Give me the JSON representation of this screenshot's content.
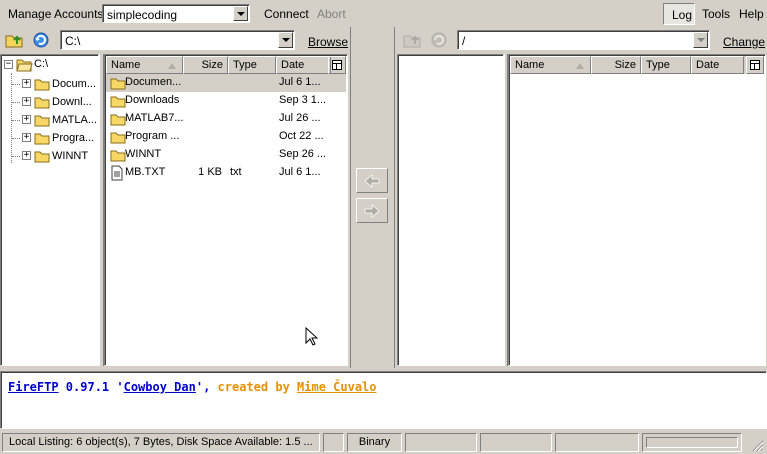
{
  "toolbar": {
    "manage_accounts": "Manage Accounts",
    "account_value": "simplecoding",
    "connect": "Connect",
    "abort": "Abort",
    "log": "Log",
    "tools": "Tools",
    "help": "Help"
  },
  "local": {
    "path": "C:\\",
    "browse": "Browse",
    "tree": {
      "root": "C:\\",
      "items": [
        "Docum...",
        "Downl...",
        "MATLA...",
        "Progra...",
        "WINNT"
      ]
    },
    "columns": {
      "name": "Name",
      "size": "Size",
      "type": "Type",
      "date": "Date"
    },
    "files": [
      {
        "name": "Documen...",
        "size": "",
        "type": "",
        "date": "Jul 6 1...",
        "kind": "folder"
      },
      {
        "name": "Downloads",
        "size": "",
        "type": "",
        "date": "Sep 3 1...",
        "kind": "folder"
      },
      {
        "name": "MATLAB7...",
        "size": "",
        "type": "",
        "date": "Jul 26 ...",
        "kind": "folder"
      },
      {
        "name": "Program ...",
        "size": "",
        "type": "",
        "date": "Oct 22 ...",
        "kind": "folder"
      },
      {
        "name": "WINNT",
        "size": "",
        "type": "",
        "date": "Sep 26 ...",
        "kind": "folder"
      },
      {
        "name": "MB.TXT",
        "size": "1 KB",
        "type": "txt",
        "date": "Jul 6 1...",
        "kind": "file"
      }
    ]
  },
  "remote": {
    "path": "/",
    "change": "Change",
    "columns": {
      "name": "Name",
      "size": "Size",
      "type": "Type",
      "date": "Date"
    }
  },
  "log": {
    "app": "FireFTP",
    "version": " 0.97.1 '",
    "codename": "Cowboy Dan",
    "sep": "', ",
    "created_by": "created by ",
    "author": "Mime Čuvalo"
  },
  "status": {
    "listing": "Local Listing: 6 object(s), 7 Bytes, Disk Space Available: 1.5 ...",
    "mode": "Binary"
  },
  "colors": {
    "window_bg": "#d4d0c8",
    "link_blue": "#0000cc",
    "credit_orange": "#e69100",
    "folder_yellow": "#f7d766"
  }
}
